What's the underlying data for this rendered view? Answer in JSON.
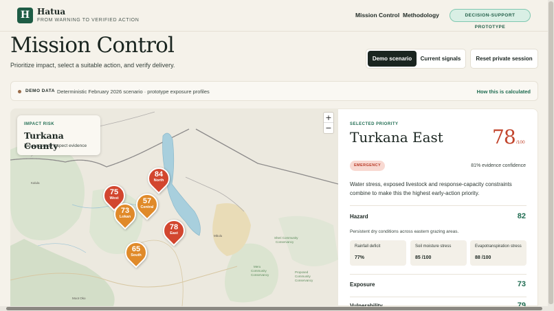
{
  "brand": {
    "logo_letter": "H",
    "name": "Hatua",
    "tagline": "FROM WARNING TO VERIFIED ACTION"
  },
  "nav": {
    "items": [
      "Mission Control",
      "Methodology"
    ],
    "badge": "DECISION-SUPPORT PROTOTYPE"
  },
  "page": {
    "title": "Mission Control",
    "subtitle": "Prioritize impact, select a suitable action, and verify delivery."
  },
  "scenario": {
    "demo_label": "Demo scenario",
    "current_label": "Current signals",
    "reset_label": "Reset private session",
    "active": "Demo scenario"
  },
  "demo_bar": {
    "label": "DEMO DATA",
    "text": "Deterministic February 2026 scenario · prototype exposure profiles",
    "link": "How this is calculated"
  },
  "map": {
    "zoom_in": "+",
    "zoom_out": "−",
    "risk_card": {
      "label": "IMPACT RISK",
      "county": "Turkana County",
      "hint": "Tap a score to inspect evidence"
    },
    "pins": [
      {
        "score": "84",
        "name": "North",
        "color": "#d2462f"
      },
      {
        "score": "75",
        "name": "West",
        "color": "#d2462f"
      },
      {
        "score": "73",
        "name": "Lokan",
        "color": "#e08a2a"
      },
      {
        "score": "57",
        "name": "Central",
        "color": "#e08a2a"
      },
      {
        "score": "78",
        "name": "East",
        "color": "#d2462f"
      },
      {
        "score": "65",
        "name": "South",
        "color": "#e08a2a"
      }
    ],
    "place_labels": [
      "Sheri Community Conservancy",
      "Lake Turkana",
      "Mbulu",
      "Proposed Community Conservancy",
      "Meru Community Conservancy",
      "Kalula",
      "Moot Oko"
    ]
  },
  "selected": {
    "label": "SELECTED PRIORITY",
    "name": "Turkana East",
    "score": "78",
    "score_max": "/100",
    "badge": "EMERGENCY",
    "confidence": "81% evidence confidence",
    "summary": "Water stress, exposed livestock and response-capacity constraints combine to make this the highest early-action priority.",
    "hazard": {
      "name": "Hazard",
      "value": "82",
      "description": "Persistent dry conditions across eastern grazing areas.",
      "subs": [
        {
          "label": "Rainfall deficit",
          "value": "77%"
        },
        {
          "label": "Soil moisture stress",
          "value": "85 /100"
        },
        {
          "label": "Evapotranspiration stress",
          "value": "88 /100"
        }
      ]
    },
    "exposure": {
      "name": "Exposure",
      "value": "73"
    },
    "vulnerability": {
      "name": "Vulnerability",
      "value": "79"
    }
  },
  "colors": {
    "accent": "#1e5c45",
    "danger": "#c2452d",
    "warn": "#e08a2a"
  }
}
